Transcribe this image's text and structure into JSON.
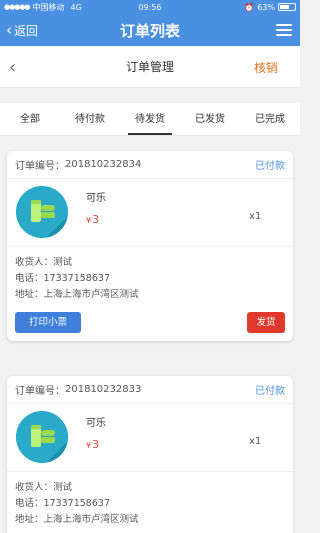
{
  "status_bar": {
    "signal": "●●●●●",
    "carrier": "中国移动",
    "network": "4G",
    "time": "09:56",
    "battery": "63%",
    "battery_level": 0.63
  },
  "app_bar": {
    "back_label": "返回",
    "title": "订单列表"
  },
  "sub_header": {
    "title": "订单管理",
    "action": "核销"
  },
  "tabs": [
    {
      "label": "全部"
    },
    {
      "label": "待付款"
    },
    {
      "label": "待发货"
    },
    {
      "label": "已发货"
    },
    {
      "label": "已完成"
    }
  ],
  "orders": [
    {
      "order_label": "订单编号：",
      "order_no": "201810232834",
      "status": "已付款",
      "product_name": "可乐",
      "currency": "¥",
      "price": "3",
      "qty": "x1",
      "receiver": "收货人：测试",
      "phone": "电话：17337158637",
      "address": "地址：上海上海市卢湾区测试",
      "print_label": "打印小票",
      "ship_label": "发货"
    },
    {
      "order_label": "订单编号：",
      "order_no": "201810232833",
      "status": "已付款",
      "product_name": "可乐",
      "currency": "¥",
      "price": "3",
      "qty": "x1",
      "receiver": "收货人：测试",
      "phone": "电话：17337158637",
      "address": "地址：上海上海市卢湾区测试"
    }
  ]
}
